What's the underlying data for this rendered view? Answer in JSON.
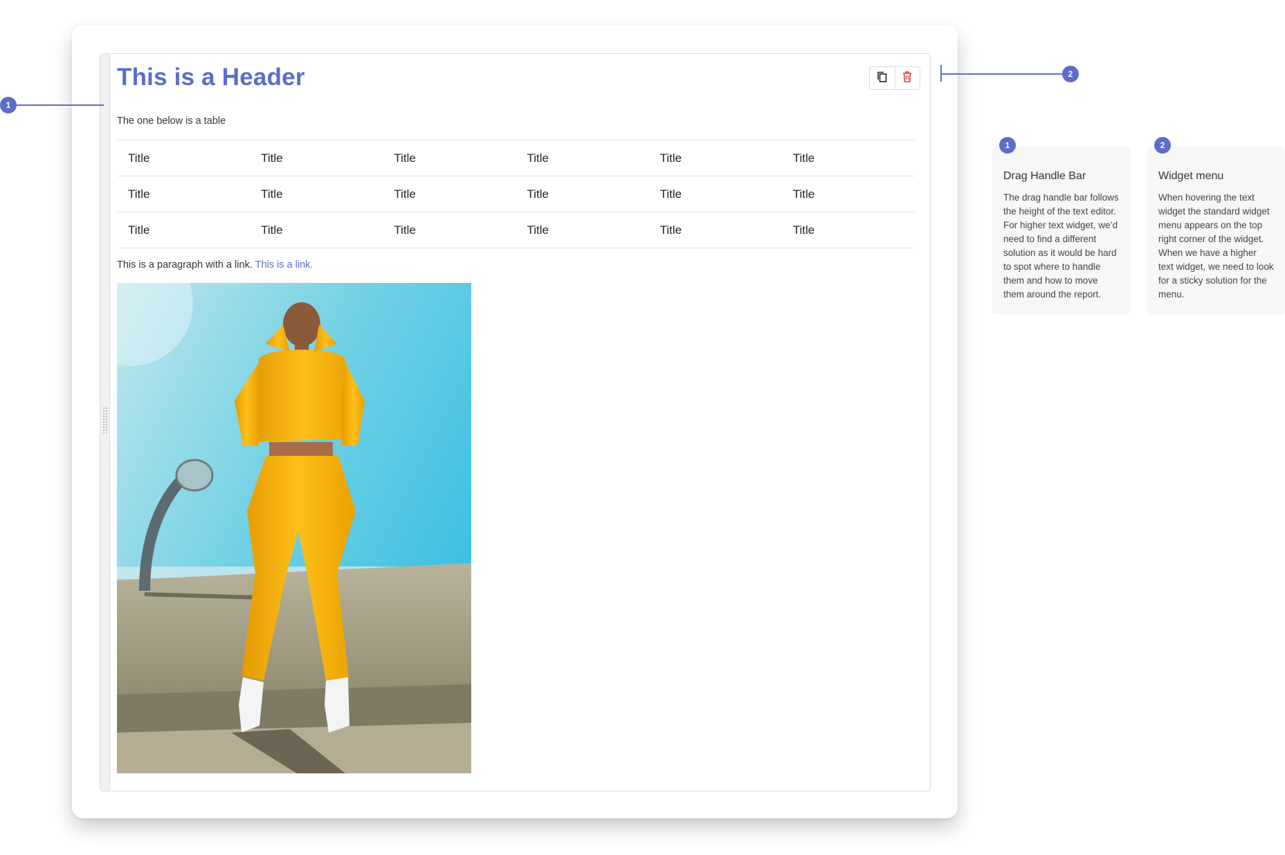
{
  "widget": {
    "header": "This is a Header",
    "intro_text": "The one below is a table",
    "table": {
      "rows": [
        [
          "Title",
          "Title",
          "Title",
          "Title",
          "Title",
          "Title"
        ],
        [
          "Title",
          "Title",
          "Title",
          "Title",
          "Title",
          "Title"
        ],
        [
          "Title",
          "Title",
          "Title",
          "Title",
          "Title",
          "Title"
        ]
      ]
    },
    "paragraph_text": "This is a paragraph with a link.",
    "link_text": "This is a link.",
    "menu": {
      "copy_icon": "copy-icon",
      "delete_icon": "trash-icon"
    }
  },
  "annotations": [
    {
      "number": "1",
      "title": "Drag Handle Bar",
      "body": "The drag handle bar follows the height of the text editor. For higher text widget, we’d need to find a different solution as it would be hard to spot where to handle them and how to move them around the report."
    },
    {
      "number": "2",
      "title": "Widget menu",
      "body": "When hovering the text widget the standard widget menu appears on the top right corner of the widget. When we have a higher text widget, we need to look for a sticky solution for the menu."
    }
  ],
  "colors": {
    "accent": "#5b6ccb",
    "delete": "#e53935"
  }
}
